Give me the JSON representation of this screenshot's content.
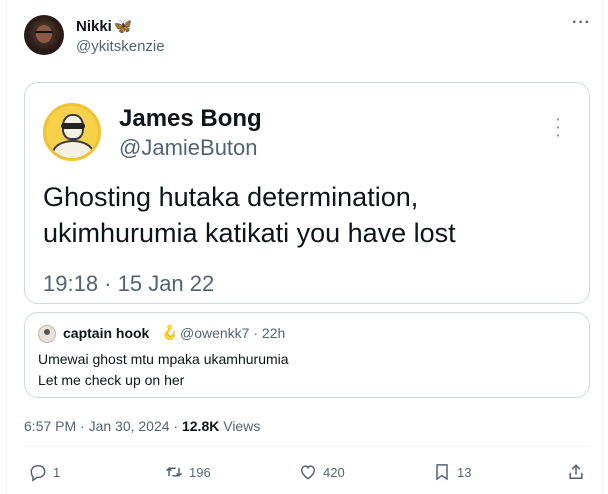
{
  "author": {
    "name": "Nikki",
    "badge": "🦋",
    "handle": "@ykitskenzie"
  },
  "embedded_image": {
    "name": "James Bong",
    "handle": "@JamieButon",
    "text_line1": "Ghosting hutaka determination,",
    "text_line2": "ukimhurumia katikati you have lost",
    "timestamp": "19:18 · 15 Jan 22"
  },
  "quoted": {
    "name": "captain hook",
    "emoji": "🪝",
    "handle_time": "@owenkk7 · 22h",
    "line1": "Umewai ghost mtu mpaka ukamhurumia",
    "line2": "Let me check up on her"
  },
  "meta": {
    "time": "6:57 PM · Jan 30, 2024 · ",
    "views_count": "12.8K",
    "views_label": " Views"
  },
  "actions": {
    "replies": "1",
    "reposts": "196",
    "likes": "420",
    "bookmarks": "13"
  },
  "icons": [
    "more-icon",
    "reply-icon",
    "repost-icon",
    "like-icon",
    "bookmark-icon",
    "share-icon"
  ]
}
